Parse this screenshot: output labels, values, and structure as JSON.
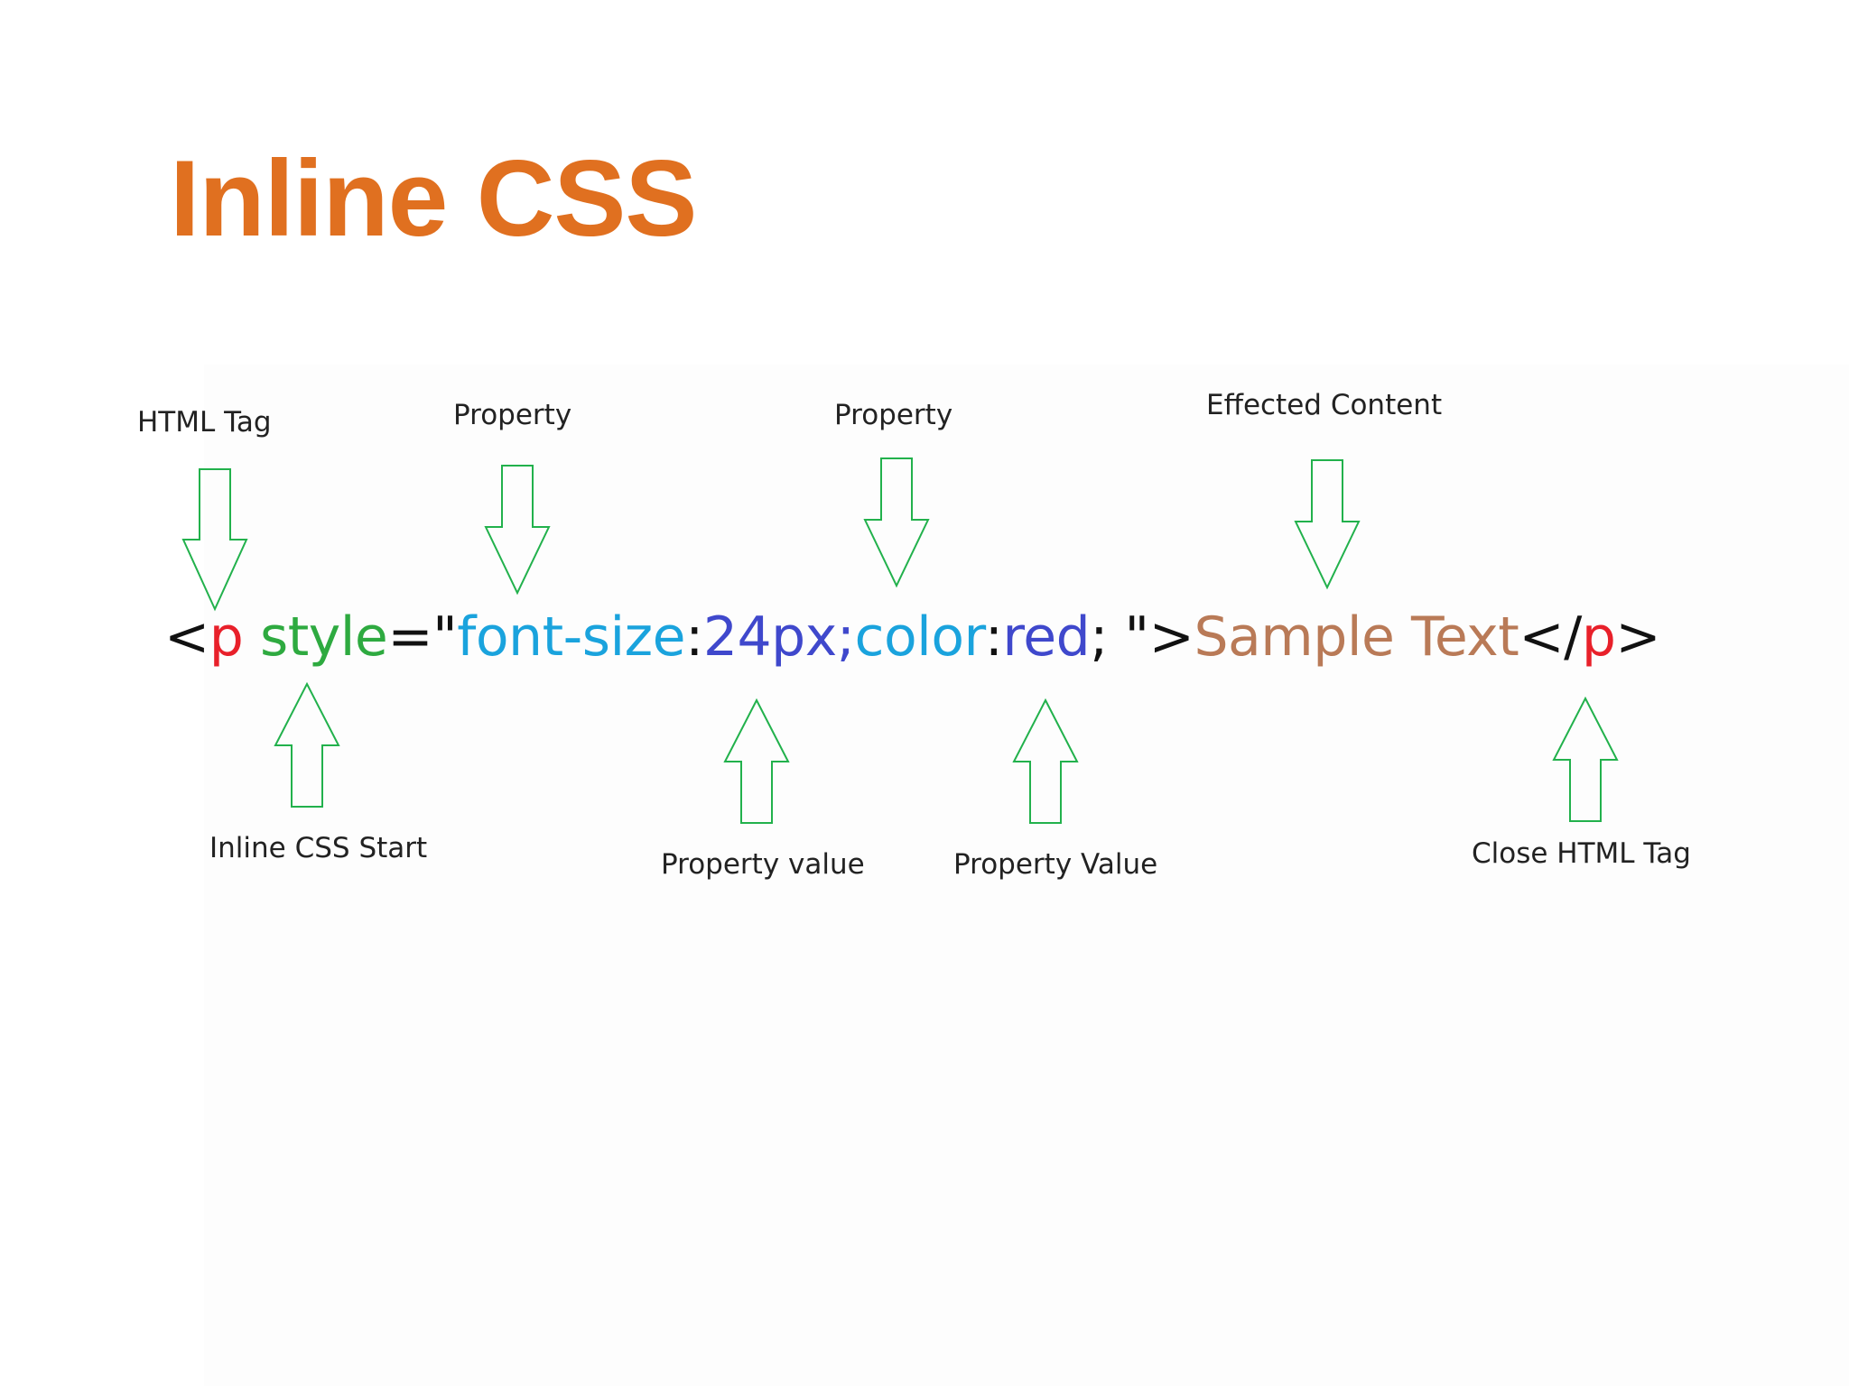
{
  "slide": {
    "title": "Inline CSS",
    "title_color": "#E07020"
  },
  "code": {
    "tokens": [
      {
        "text": "<",
        "role": "bracket",
        "color": "#111111"
      },
      {
        "text": "p",
        "role": "tag-name",
        "color": "#E8202A"
      },
      {
        "text": " ",
        "role": "space",
        "color": "#111111"
      },
      {
        "text": "style",
        "role": "attribute",
        "color": "#2EAA40"
      },
      {
        "text": "=\"",
        "role": "punctuation",
        "color": "#111111"
      },
      {
        "text": "font-size",
        "role": "property",
        "color": "#1AA3DD"
      },
      {
        "text": ":",
        "role": "colon",
        "color": "#111111"
      },
      {
        "text": "24px",
        "role": "value",
        "color": "#3F48CC"
      },
      {
        "text": ";",
        "role": "semicolon",
        "color": "#3F48CC"
      },
      {
        "text": "color",
        "role": "property",
        "color": "#1AA3DD"
      },
      {
        "text": ":",
        "role": "colon",
        "color": "#111111"
      },
      {
        "text": "red",
        "role": "value",
        "color": "#3F48CC"
      },
      {
        "text": ";",
        "role": "semicolon",
        "color": "#111111"
      },
      {
        "text": " \">",
        "role": "punctuation",
        "color": "#111111"
      },
      {
        "text": "Sample Text",
        "role": "content",
        "color": "#B97A57"
      },
      {
        "text": "</",
        "role": "bracket",
        "color": "#111111"
      },
      {
        "text": "p",
        "role": "tag-name",
        "color": "#E8202A"
      },
      {
        "text": ">",
        "role": "bracket",
        "color": "#111111"
      }
    ]
  },
  "annotations": {
    "top": [
      {
        "label": "HTML Tag",
        "direction": "down"
      },
      {
        "label": "Property",
        "direction": "down"
      },
      {
        "label": "Property",
        "direction": "down"
      },
      {
        "label": "Effected Content",
        "direction": "down"
      }
    ],
    "bottom": [
      {
        "label": "Inline CSS Start",
        "direction": "up"
      },
      {
        "label": "Property value",
        "direction": "up"
      },
      {
        "label": "Property Value",
        "direction": "up"
      },
      {
        "label": "Close HTML Tag",
        "direction": "up"
      }
    ],
    "arrow_color": "#22B14C"
  }
}
